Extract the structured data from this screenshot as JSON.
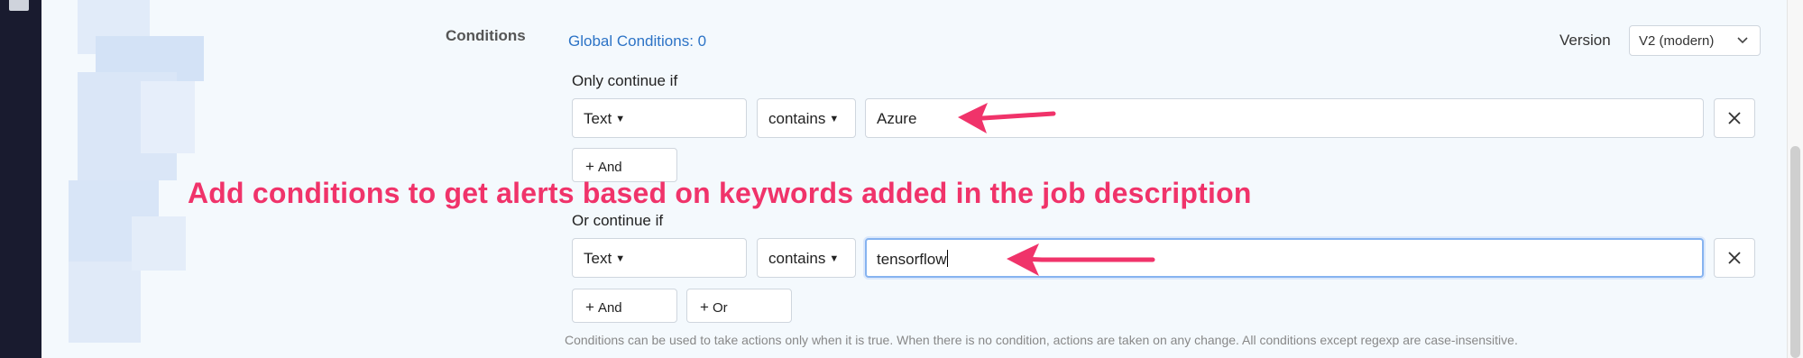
{
  "section_label": "Conditions",
  "global_conditions_link": "Global Conditions: 0",
  "version": {
    "label": "Version",
    "selected": "V2 (modern)"
  },
  "groups": [
    {
      "heading": "Only continue if",
      "field": "Text",
      "operator": "contains",
      "value": "Azure",
      "buttons": [
        "And"
      ]
    },
    {
      "heading": "Or continue if",
      "field": "Text",
      "operator": "contains",
      "value": "tensorflow",
      "buttons": [
        "And",
        "Or"
      ]
    }
  ],
  "annotation": "Add conditions to get alerts based on keywords added in the job description",
  "help_text": "Conditions can be used to take actions only when it is true. When there is no condition, actions are taken on any change. All conditions except regexp are case-insensitive.",
  "icons": {
    "close": "close-icon",
    "caret": "caret-down-icon",
    "chevron": "chevron-down-icon",
    "plus": "plus-icon"
  },
  "colors": {
    "annotation": "#f0336a",
    "link": "#2c73c6",
    "sidebar": "#191b2f",
    "focus_border": "#86b3f0"
  }
}
